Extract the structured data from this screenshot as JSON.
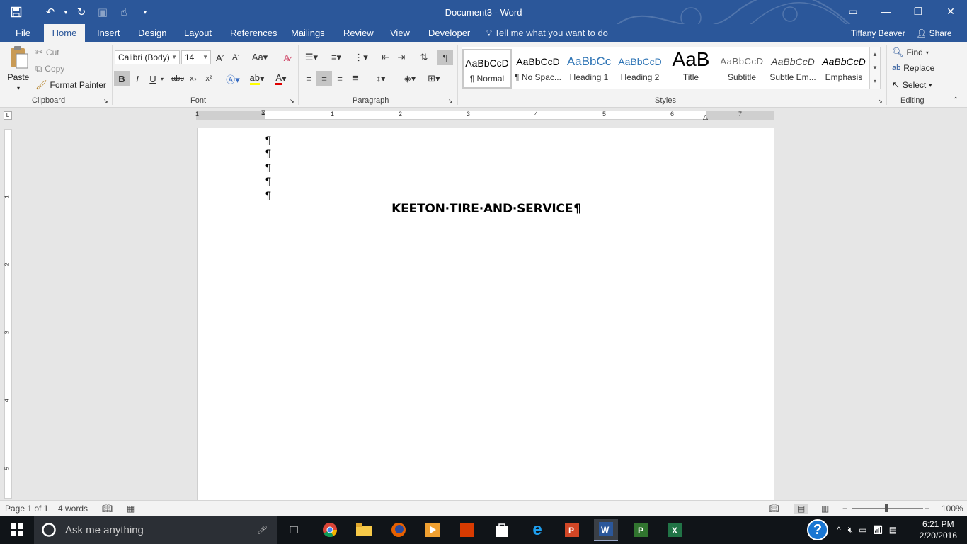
{
  "window": {
    "title": "Document3 - Word"
  },
  "tabs": [
    "File",
    "Home",
    "Insert",
    "Design",
    "Layout",
    "References",
    "Mailings",
    "Review",
    "View",
    "Developer"
  ],
  "active_tab": "Home",
  "tell_me": "Tell me what you want to do",
  "user_name": "Tiffany Beaver",
  "share_label": "Share",
  "clipboard": {
    "paste_label": "Paste",
    "cut_label": "Cut",
    "copy_label": "Copy",
    "format_painter_label": "Format Painter",
    "group_label": "Clipboard"
  },
  "font": {
    "family": "Calibri (Body)",
    "size": "14",
    "group_label": "Font"
  },
  "paragraph": {
    "group_label": "Paragraph"
  },
  "styles": {
    "group_label": "Styles",
    "items": [
      {
        "preview": "AaBbCcD",
        "name": "¶ Normal"
      },
      {
        "preview": "AaBbCcD",
        "name": "¶ No Spac..."
      },
      {
        "preview": "AaBbCc",
        "name": "Heading 1"
      },
      {
        "preview": "AaBbCcD",
        "name": "Heading 2"
      },
      {
        "preview": "AaB",
        "name": "Title"
      },
      {
        "preview": "AaBbCcD",
        "name": "Subtitle"
      },
      {
        "preview": "AaBbCcD",
        "name": "Subtle Em..."
      },
      {
        "preview": "AaBbCcD",
        "name": "Emphasis"
      }
    ]
  },
  "editing": {
    "group_label": "Editing",
    "find_label": "Find",
    "replace_label": "Replace",
    "select_label": "Select"
  },
  "ruler": {
    "h_numbers": [
      "1",
      "1",
      "2",
      "3",
      "4",
      "5",
      "6",
      "7"
    ],
    "v_numbers": [
      "1",
      "2",
      "3",
      "4",
      "5"
    ]
  },
  "document": {
    "empty_marks": [
      "¶",
      "¶",
      "¶",
      "¶",
      "¶"
    ],
    "heading_text": "KEETON·TIRE·AND·SERVICE",
    "heading_mark": "¶"
  },
  "status": {
    "page": "Page 1 of 1",
    "words": "4 words",
    "zoom": "100%"
  },
  "taskbar": {
    "search_placeholder": "Ask me anything",
    "time": "6:21 PM",
    "date": "2/20/2016"
  }
}
